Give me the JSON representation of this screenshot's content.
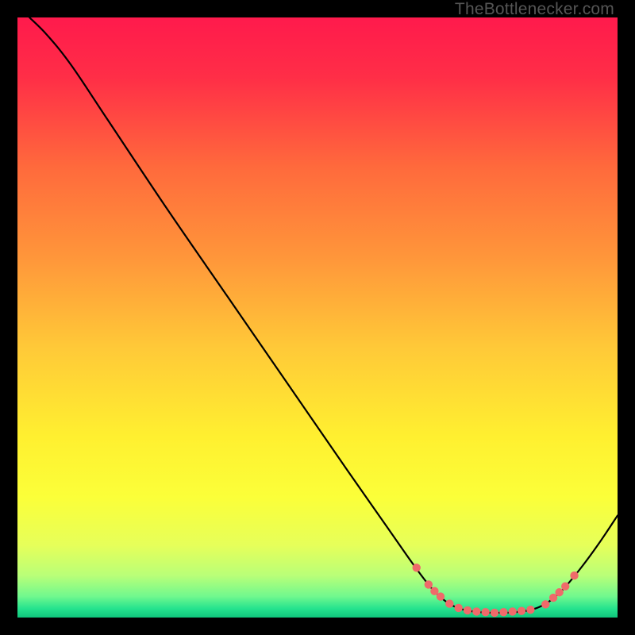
{
  "watermark": "TheBottlenecker.com",
  "chart_data": {
    "type": "line",
    "title": "",
    "xlabel": "",
    "ylabel": "",
    "xlim": [
      0,
      100
    ],
    "ylim": [
      0,
      100
    ],
    "gradient_stops": [
      {
        "offset": 0.0,
        "color": "#ff1a4c"
      },
      {
        "offset": 0.1,
        "color": "#ff2e47"
      },
      {
        "offset": 0.25,
        "color": "#ff6a3c"
      },
      {
        "offset": 0.4,
        "color": "#ff963a"
      },
      {
        "offset": 0.55,
        "color": "#ffc938"
      },
      {
        "offset": 0.7,
        "color": "#fff030"
      },
      {
        "offset": 0.8,
        "color": "#fbff39"
      },
      {
        "offset": 0.88,
        "color": "#e6ff5a"
      },
      {
        "offset": 0.93,
        "color": "#b9ff78"
      },
      {
        "offset": 0.965,
        "color": "#70f88e"
      },
      {
        "offset": 0.985,
        "color": "#25e38e"
      },
      {
        "offset": 1.0,
        "color": "#0fc57c"
      }
    ],
    "series": [
      {
        "name": "bottleneck-curve",
        "color": "#000000",
        "stroke_width": 2.2,
        "points": [
          {
            "x": 2.0,
            "y": 100.0
          },
          {
            "x": 5.0,
            "y": 97.0
          },
          {
            "x": 9.0,
            "y": 92.0
          },
          {
            "x": 15.0,
            "y": 83.0
          },
          {
            "x": 25.0,
            "y": 68.0
          },
          {
            "x": 35.0,
            "y": 53.5
          },
          {
            "x": 45.0,
            "y": 39.0
          },
          {
            "x": 55.0,
            "y": 24.5
          },
          {
            "x": 62.0,
            "y": 14.5
          },
          {
            "x": 66.0,
            "y": 8.8
          },
          {
            "x": 69.0,
            "y": 4.9
          },
          {
            "x": 71.5,
            "y": 2.6
          },
          {
            "x": 74.0,
            "y": 1.4
          },
          {
            "x": 77.0,
            "y": 0.9
          },
          {
            "x": 80.0,
            "y": 0.8
          },
          {
            "x": 83.0,
            "y": 0.9
          },
          {
            "x": 86.0,
            "y": 1.4
          },
          {
            "x": 88.5,
            "y": 2.6
          },
          {
            "x": 91.0,
            "y": 4.8
          },
          {
            "x": 94.0,
            "y": 8.4
          },
          {
            "x": 97.0,
            "y": 12.5
          },
          {
            "x": 100.0,
            "y": 17.0
          }
        ]
      }
    ],
    "markers": {
      "color": "#ef6a6a",
      "radius": 5.2,
      "points": [
        {
          "x": 66.5,
          "y": 8.3
        },
        {
          "x": 68.5,
          "y": 5.5
        },
        {
          "x": 69.5,
          "y": 4.4
        },
        {
          "x": 70.5,
          "y": 3.5
        },
        {
          "x": 72.0,
          "y": 2.3
        },
        {
          "x": 73.5,
          "y": 1.6
        },
        {
          "x": 75.0,
          "y": 1.2
        },
        {
          "x": 76.5,
          "y": 1.0
        },
        {
          "x": 78.0,
          "y": 0.9
        },
        {
          "x": 79.5,
          "y": 0.8
        },
        {
          "x": 81.0,
          "y": 0.9
        },
        {
          "x": 82.5,
          "y": 1.0
        },
        {
          "x": 84.0,
          "y": 1.1
        },
        {
          "x": 85.5,
          "y": 1.3
        },
        {
          "x": 88.0,
          "y": 2.2
        },
        {
          "x": 89.3,
          "y": 3.3
        },
        {
          "x": 90.3,
          "y": 4.2
        },
        {
          "x": 91.3,
          "y": 5.2
        },
        {
          "x": 92.8,
          "y": 7.0
        }
      ]
    }
  }
}
